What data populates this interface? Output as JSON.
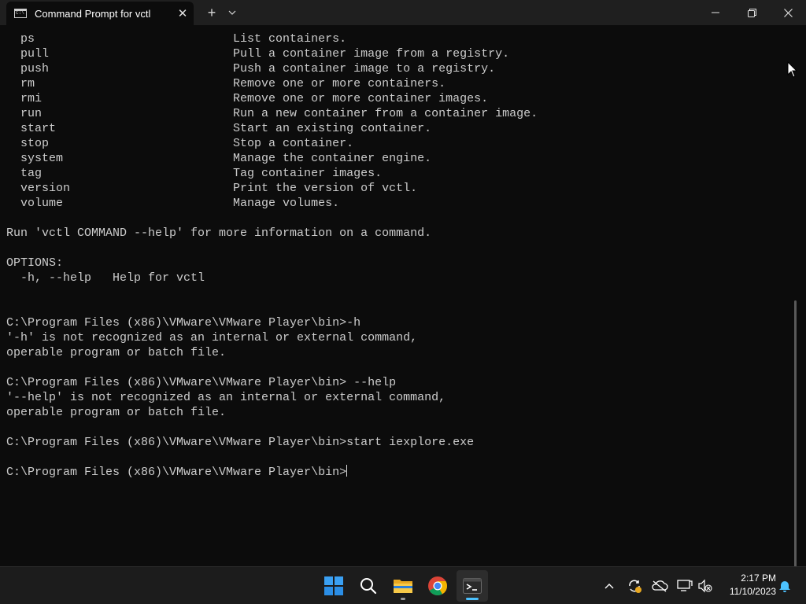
{
  "window": {
    "tab_title": "Command Prompt for vctl",
    "tab_close_glyph": "✕",
    "new_tab_glyph": "+",
    "buttons": [
      "minimize",
      "maximize",
      "close"
    ]
  },
  "terminal": {
    "lines": [
      "  ps                            List containers.",
      "  pull                          Pull a container image from a registry.",
      "  push                          Push a container image to a registry.",
      "  rm                            Remove one or more containers.",
      "  rmi                           Remove one or more container images.",
      "  run                           Run a new container from a container image.",
      "  start                         Start an existing container.",
      "  stop                          Stop a container.",
      "  system                        Manage the container engine.",
      "  tag                           Tag container images.",
      "  version                       Print the version of vctl.",
      "  volume                        Manage volumes.",
      "",
      "Run 'vctl COMMAND --help' for more information on a command.",
      "",
      "OPTIONS:",
      "  -h, --help   Help for vctl",
      "",
      "",
      "C:\\Program Files (x86)\\VMware\\VMware Player\\bin>-h",
      "'-h' is not recognized as an internal or external command,",
      "operable program or batch file.",
      "",
      "C:\\Program Files (x86)\\VMware\\VMware Player\\bin> --help",
      "'--help' is not recognized as an internal or external command,",
      "operable program or batch file.",
      "",
      "C:\\Program Files (x86)\\VMware\\VMware Player\\bin>start iexplore.exe",
      ""
    ],
    "prompt": "C:\\Program Files (x86)\\VMware\\VMware Player\\bin>"
  },
  "taskbar": {
    "apps": [
      "windows-start-icon",
      "search-icon",
      "file-explorer-icon",
      "chrome-icon",
      "terminal-icon"
    ],
    "tray": [
      "chevron-up-icon",
      "sync-icon",
      "onedrive-icon",
      "display-icon",
      "volume-muted-icon",
      "notification-bell-icon"
    ],
    "time": "2:17 PM",
    "date": "11/10/2023"
  },
  "colors": {
    "terminal_bg": "#0c0c0c",
    "terminal_text": "#cccccc",
    "titlebar_bg": "#1f1f1f",
    "taskbar_bg": "#1c1c1c",
    "accent_blue": "#0078d4"
  }
}
